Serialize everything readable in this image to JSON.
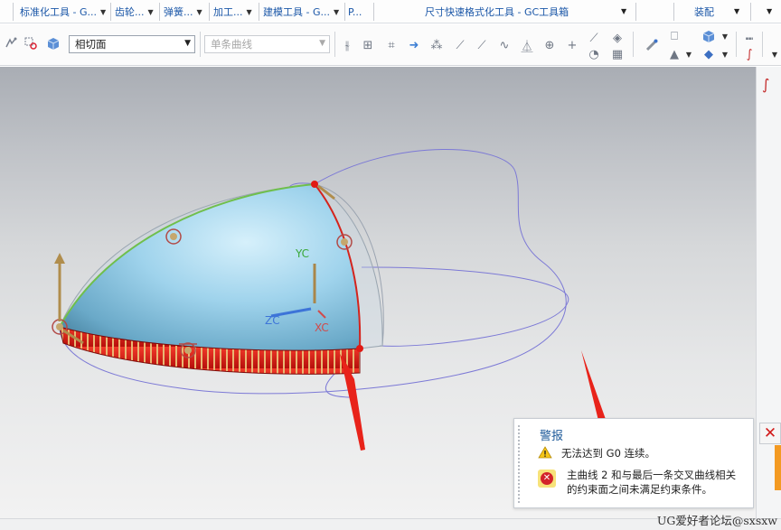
{
  "tabs": [
    {
      "label": "标准化工具 - G...",
      "name": "tab-standard-tools"
    },
    {
      "label": "齿轮...",
      "name": "tab-gear"
    },
    {
      "label": "弹簧...",
      "name": "tab-spring"
    },
    {
      "label": "加工...",
      "name": "tab-machining"
    },
    {
      "label": "建模工具 - G...",
      "name": "tab-modeling-tools"
    },
    {
      "label": "P...",
      "name": "tab-p"
    },
    {
      "label": "尺寸快速格式化工具 - GC工具箱",
      "name": "tab-dimension-format"
    },
    {
      "label": "装配",
      "name": "tab-assembly"
    }
  ],
  "toolbar": {
    "constraint_combo": "相切面",
    "curve_combo_placeholder": "单条曲线"
  },
  "viewport": {
    "axes": {
      "yc": "YC",
      "zc": "ZC",
      "xc": "XC"
    }
  },
  "alert": {
    "title": "警报",
    "warning_text": "无法达到 G0 连续。",
    "error_text_line1": "主曲线 2 和与最后一条交叉曲线相关",
    "error_text_line2": "的约束面之间未满足约束条件。",
    "close_symbol": "✕"
  },
  "watermark": "UG爱好者论坛@sxsxw",
  "colors": {
    "tab_text": "#1b57a8",
    "surface_blue": "#8fcbe8",
    "red_band": "#e11a14",
    "guide_curve": "#7c79d6",
    "green_curve": "#6fbf4c",
    "annotation_arrow": "#e8231a",
    "alert_title": "#1e5a9a"
  }
}
